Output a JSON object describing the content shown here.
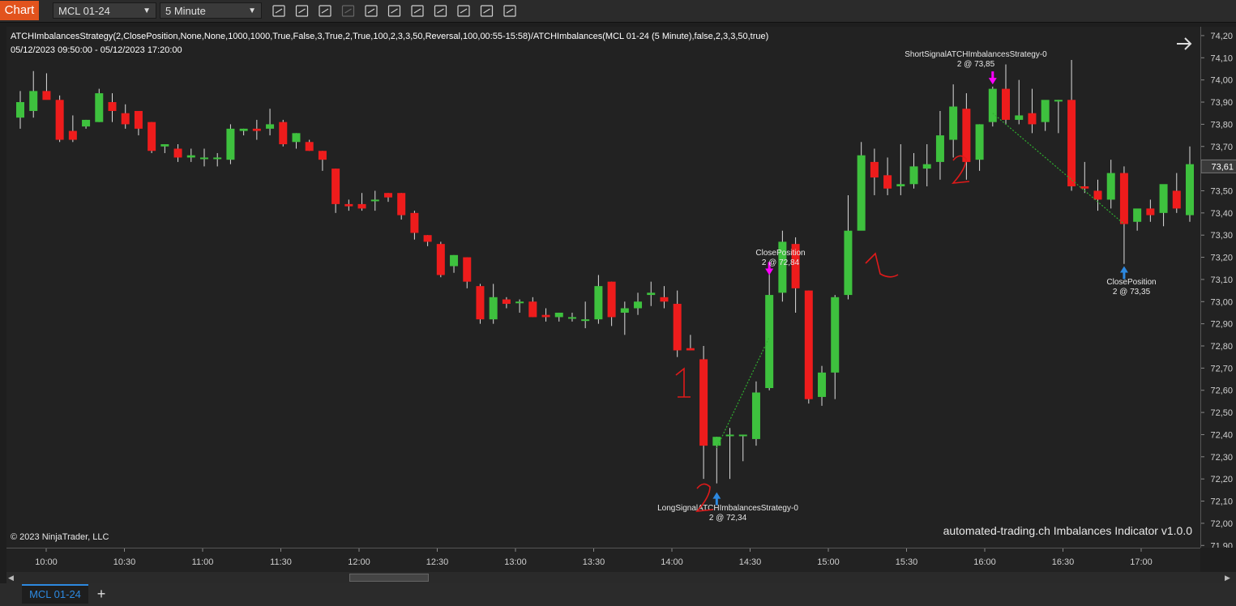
{
  "toolbar": {
    "chart_label": "Chart",
    "instrument": "MCL 01-24",
    "interval": "5 Minute",
    "icons": [
      "bar-type-icon",
      "drawing-tool-icon",
      "zoom-in-icon",
      "zoom-out-icon",
      "pointer-icon",
      "data-series-icon",
      "strategies-icon",
      "indicators-icon",
      "chart-trader-icon",
      "properties-icon",
      "menu-icon"
    ]
  },
  "header": {
    "strategy_line": "ATCHImbalancesStrategy(2,ClosePosition,None,None,1000,1000,True,False,3,True,2,True,100,2,3,3,50,Reversal,100,00:55-15:58)/ATCHImbalances(MCL 01-24 (5 Minute),false,2,3,3,50,true)",
    "date_range": "05/12/2023 09:50:00 - 05/12/2023 17:20:00"
  },
  "footer": {
    "copyright": "© 2023 NinjaTrader, LLC",
    "indicator_label": "automated-trading.ch Imbalances Indicator v1.0.0"
  },
  "bottom": {
    "tab": "MCL 01-24",
    "add": "+"
  },
  "colors": {
    "up": "#3ec13e",
    "down": "#ee1c1c",
    "background": "#222222",
    "marker": "#ff00ff",
    "arrow": "#2d89e0",
    "annotation": "#e01a1a"
  },
  "chart_data": {
    "type": "candlestick",
    "y_ticks": [
      "74,20",
      "74,10",
      "74,00",
      "73,90",
      "73,80",
      "73,70",
      "73,60",
      "73,50",
      "73,40",
      "73,30",
      "73,20",
      "73,10",
      "73,00",
      "72,90",
      "72,80",
      "72,70",
      "72,60",
      "72,50",
      "72,40",
      "72,30",
      "72,20",
      "72,10",
      "72,00",
      "71,90"
    ],
    "ylim": [
      71.89,
      74.24
    ],
    "current_price": "73,61",
    "x_ticks": [
      "10:00",
      "10:30",
      "11:00",
      "11:30",
      "12:00",
      "12:30",
      "13:00",
      "13:30",
      "14:00",
      "14:30",
      "15:00",
      "15:30",
      "16:00",
      "16:30",
      "17:00"
    ],
    "candles": [
      [
        73.83,
        73.95,
        73.9,
        73.78
      ],
      [
        73.86,
        74.04,
        73.95,
        73.83
      ],
      [
        73.95,
        74.03,
        73.91,
        73.92
      ],
      [
        73.91,
        73.93,
        73.73,
        73.72
      ],
      [
        73.77,
        73.84,
        73.73,
        73.72
      ],
      [
        73.79,
        73.82,
        73.82,
        73.78
      ],
      [
        73.81,
        73.96,
        73.94,
        73.81
      ],
      [
        73.9,
        73.94,
        73.86,
        73.81
      ],
      [
        73.85,
        73.89,
        73.8,
        73.78
      ],
      [
        73.86,
        73.85,
        73.78,
        73.75
      ],
      [
        73.81,
        73.81,
        73.68,
        73.67
      ],
      [
        73.7,
        73.71,
        73.71,
        73.67
      ],
      [
        73.69,
        73.71,
        73.65,
        73.63
      ],
      [
        73.65,
        73.69,
        73.66,
        73.63
      ],
      [
        73.65,
        73.69,
        73.65,
        73.61
      ],
      [
        73.65,
        73.67,
        73.65,
        73.61
      ],
      [
        73.64,
        73.8,
        73.78,
        73.62
      ],
      [
        73.77,
        73.78,
        73.78,
        73.75
      ],
      [
        73.78,
        73.82,
        73.77,
        73.73
      ],
      [
        73.78,
        73.87,
        73.8,
        73.75
      ],
      [
        73.81,
        73.82,
        73.71,
        73.7
      ],
      [
        73.72,
        73.76,
        73.76,
        73.69
      ],
      [
        73.72,
        73.73,
        73.68,
        73.68
      ],
      [
        73.68,
        73.68,
        73.64,
        73.59
      ],
      [
        73.6,
        73.6,
        73.44,
        73.4
      ],
      [
        73.44,
        73.46,
        73.43,
        73.41
      ],
      [
        73.44,
        73.49,
        73.42,
        73.41
      ],
      [
        73.46,
        73.5,
        73.46,
        73.41
      ],
      [
        73.49,
        73.49,
        73.47,
        73.45
      ],
      [
        73.49,
        73.49,
        73.39,
        73.37
      ],
      [
        73.4,
        73.41,
        73.31,
        73.28
      ],
      [
        73.3,
        73.3,
        73.27,
        73.25
      ],
      [
        73.26,
        73.27,
        73.12,
        73.11
      ],
      [
        73.16,
        73.21,
        73.21,
        73.13
      ],
      [
        73.2,
        73.2,
        73.09,
        73.06
      ],
      [
        73.07,
        73.08,
        72.92,
        72.9
      ],
      [
        72.92,
        73.08,
        73.02,
        72.9
      ],
      [
        73.01,
        73.02,
        72.99,
        72.97
      ],
      [
        73.0,
        73.01,
        73.0,
        72.95
      ],
      [
        73.0,
        73.02,
        72.93,
        72.93
      ],
      [
        72.94,
        72.97,
        72.93,
        72.91
      ],
      [
        72.93,
        72.95,
        72.95,
        72.91
      ],
      [
        72.93,
        72.95,
        72.93,
        72.91
      ],
      [
        72.92,
        73.0,
        72.92,
        72.88
      ],
      [
        72.92,
        73.12,
        73.07,
        72.9
      ],
      [
        73.09,
        73.09,
        72.93,
        72.89
      ],
      [
        72.95,
        73.0,
        72.97,
        72.85
      ],
      [
        72.97,
        73.04,
        73.0,
        72.94
      ],
      [
        73.03,
        73.09,
        73.04,
        72.98
      ],
      [
        73.02,
        73.07,
        73.0,
        72.97
      ],
      [
        72.99,
        73.05,
        72.78,
        72.75
      ],
      [
        72.79,
        72.85,
        72.78,
        72.78
      ],
      [
        72.74,
        72.8,
        72.35,
        72.2
      ],
      [
        72.35,
        72.39,
        72.39,
        72.18
      ],
      [
        72.4,
        72.43,
        72.4,
        72.2
      ],
      [
        72.4,
        72.4,
        72.4,
        72.28
      ],
      [
        72.38,
        72.64,
        72.59,
        72.35
      ],
      [
        72.61,
        73.13,
        73.03,
        72.6
      ],
      [
        73.04,
        73.32,
        73.27,
        73.0
      ],
      [
        73.26,
        73.29,
        73.06,
        72.95
      ],
      [
        73.05,
        73.05,
        72.56,
        72.54
      ],
      [
        72.57,
        72.71,
        72.68,
        72.53
      ],
      [
        72.68,
        73.03,
        73.02,
        72.56
      ],
      [
        73.03,
        73.48,
        73.32,
        73.01
      ],
      [
        73.32,
        73.72,
        73.66,
        73.33
      ],
      [
        73.63,
        73.69,
        73.56,
        73.48
      ],
      [
        73.57,
        73.65,
        73.51,
        73.48
      ],
      [
        73.52,
        73.71,
        73.53,
        73.48
      ],
      [
        73.53,
        73.67,
        73.61,
        73.51
      ],
      [
        73.6,
        73.71,
        73.62,
        73.52
      ],
      [
        73.63,
        73.86,
        73.75,
        73.55
      ],
      [
        73.73,
        73.98,
        73.88,
        73.65
      ],
      [
        73.87,
        73.94,
        73.63,
        73.55
      ],
      [
        73.64,
        73.8,
        73.8,
        73.59
      ],
      [
        73.81,
        73.97,
        73.96,
        73.79
      ],
      [
        73.96,
        74.07,
        73.82,
        73.8
      ],
      [
        73.82,
        74.0,
        73.84,
        73.8
      ],
      [
        73.85,
        73.96,
        73.8,
        73.76
      ],
      [
        73.81,
        73.89,
        73.91,
        73.77
      ],
      [
        73.91,
        73.91,
        73.91,
        73.76
      ],
      [
        73.91,
        74.09,
        73.52,
        73.5
      ],
      [
        73.52,
        73.63,
        73.51,
        73.49
      ],
      [
        73.5,
        73.55,
        73.46,
        73.41
      ],
      [
        73.46,
        73.64,
        73.58,
        73.42
      ],
      [
        73.58,
        73.61,
        73.35,
        73.17
      ],
      [
        73.36,
        73.41,
        73.42,
        73.32
      ],
      [
        73.42,
        73.46,
        73.39,
        73.36
      ],
      [
        73.4,
        73.48,
        73.53,
        73.34
      ],
      [
        73.5,
        73.58,
        73.42,
        73.4
      ],
      [
        73.39,
        73.7,
        73.62,
        73.36
      ]
    ],
    "annotations": [
      {
        "label": "ShortSignalATCHImbalancesStrategy-0",
        "sub": "2 @ 73,85"
      },
      {
        "label": "ClosePosition",
        "sub": "2 @ 72,84"
      },
      {
        "label": "LongSignalATCHImbalancesStrategy-0",
        "sub": "2 @ 72,34"
      },
      {
        "label": "ClosePosition",
        "sub": "2 @ 73,35"
      }
    ]
  }
}
